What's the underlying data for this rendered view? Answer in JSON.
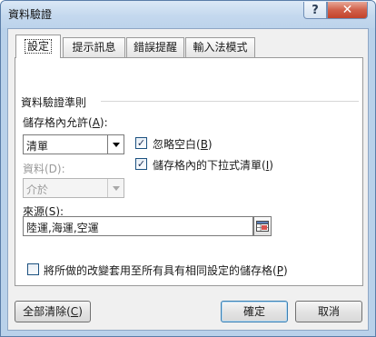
{
  "window": {
    "title": "資料驗證",
    "help_glyph": "?",
    "close_glyph": "✕"
  },
  "tabs": [
    {
      "label": "設定",
      "active": true
    },
    {
      "label": "提示訊息",
      "active": false
    },
    {
      "label": "錯誤提醒",
      "active": false
    },
    {
      "label": "輸入法模式",
      "active": false
    }
  ],
  "criteria": {
    "group_label": "資料驗證準則",
    "allow_label_pre": "儲存格內允許(",
    "allow_label_key": "A",
    "allow_label_post": "):",
    "allow_value": "清單",
    "data_label": "資料(D):",
    "data_value": "介於",
    "ignore_blank_pre": "忽略空白(",
    "ignore_blank_key": "B",
    "ignore_blank_post": ")",
    "ignore_blank_checked": true,
    "dropdown_pre": "儲存格內的下拉式清單(",
    "dropdown_key": "I",
    "dropdown_post": ")",
    "dropdown_checked": true,
    "source_label_pre": "來源(",
    "source_label_key": "S",
    "source_label_post": "):",
    "source_value": "陸運,海運,空運"
  },
  "apply_all": {
    "label_pre": "將所做的改變套用至所有具有相同設定的儲存格(",
    "label_key": "P",
    "label_post": ")",
    "checked": false
  },
  "buttons": {
    "clear_all_pre": "全部清除(",
    "clear_all_key": "C",
    "clear_all_post": ")",
    "ok": "確定",
    "cancel": "取消"
  },
  "colors": {
    "frame": "#b9d1ea",
    "close_button": "#c2432b"
  }
}
